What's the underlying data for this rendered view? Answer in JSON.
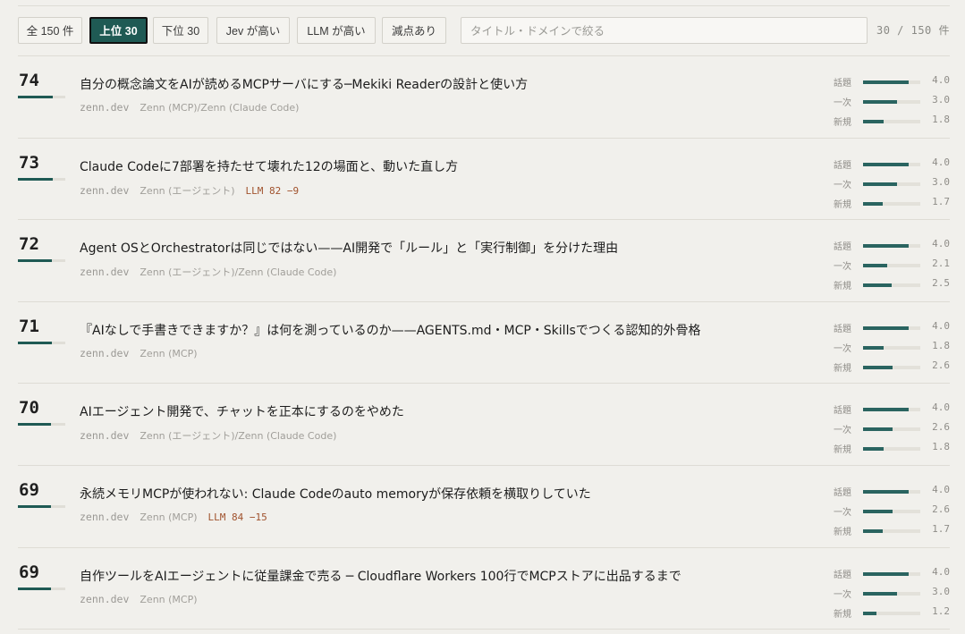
{
  "toolbar": {
    "filters": [
      {
        "label": "全 150 件",
        "active": false
      },
      {
        "label": "上位 30",
        "active": true
      },
      {
        "label": "下位 30",
        "active": false
      },
      {
        "label": "Jev が高い",
        "active": false
      },
      {
        "label": "LLM が高い",
        "active": false
      },
      {
        "label": "減点あり",
        "active": false
      }
    ],
    "search_placeholder": "タイトル・ドメインで絞る",
    "search_value": "",
    "count_text": "30 / 150 件"
  },
  "metric_labels": [
    "話題",
    "一次",
    "新規"
  ],
  "metric_max": 5.0,
  "score_max": 100,
  "colors": {
    "accent": "#1f5a54",
    "llm": "#a0522d"
  },
  "articles": [
    {
      "score": "74",
      "title": "自分の概念論文をAIが読めるMCPサーバにする─Mekiki Readerの設計と使い方",
      "domain": "zenn.dev",
      "category": "Zenn (MCP)/Zenn (Claude Code)",
      "llm": "",
      "metrics": [
        "4.0",
        "3.0",
        "1.8"
      ]
    },
    {
      "score": "73",
      "title": "Claude Codeに7部署を持たせて壊れた12の場面と、動いた直し方",
      "domain": "zenn.dev",
      "category": "Zenn (エージェント)",
      "llm": "LLM 82 −9",
      "metrics": [
        "4.0",
        "3.0",
        "1.7"
      ]
    },
    {
      "score": "72",
      "title": "Agent OSとOrchestratorは同じではない——AI開発で「ルール」と「実行制御」を分けた理由",
      "domain": "zenn.dev",
      "category": "Zenn (エージェント)/Zenn (Claude Code)",
      "llm": "",
      "metrics": [
        "4.0",
        "2.1",
        "2.5"
      ]
    },
    {
      "score": "71",
      "title": "『AIなしで手書きできますか？』は何を測っているのか——AGENTS.md・MCP・Skillsでつくる認知的外骨格",
      "domain": "zenn.dev",
      "category": "Zenn (MCP)",
      "llm": "",
      "metrics": [
        "4.0",
        "1.8",
        "2.6"
      ]
    },
    {
      "score": "70",
      "title": "AIエージェント開発で、チャットを正本にするのをやめた",
      "domain": "zenn.dev",
      "category": "Zenn (エージェント)/Zenn (Claude Code)",
      "llm": "",
      "metrics": [
        "4.0",
        "2.6",
        "1.8"
      ]
    },
    {
      "score": "69",
      "title": "永続メモリMCPが使われない: Claude Codeのauto memoryが保存依頼を横取りしていた",
      "domain": "zenn.dev",
      "category": "Zenn (MCP)",
      "llm": "LLM 84 −15",
      "metrics": [
        "4.0",
        "2.6",
        "1.7"
      ]
    },
    {
      "score": "69",
      "title": "自作ツールをAIエージェントに従量課金で売る ─ Cloudflare Workers 100行でMCPストアに出品するまで",
      "domain": "zenn.dev",
      "category": "Zenn (MCP)",
      "llm": "",
      "metrics": [
        "4.0",
        "3.0",
        "1.2"
      ]
    }
  ]
}
